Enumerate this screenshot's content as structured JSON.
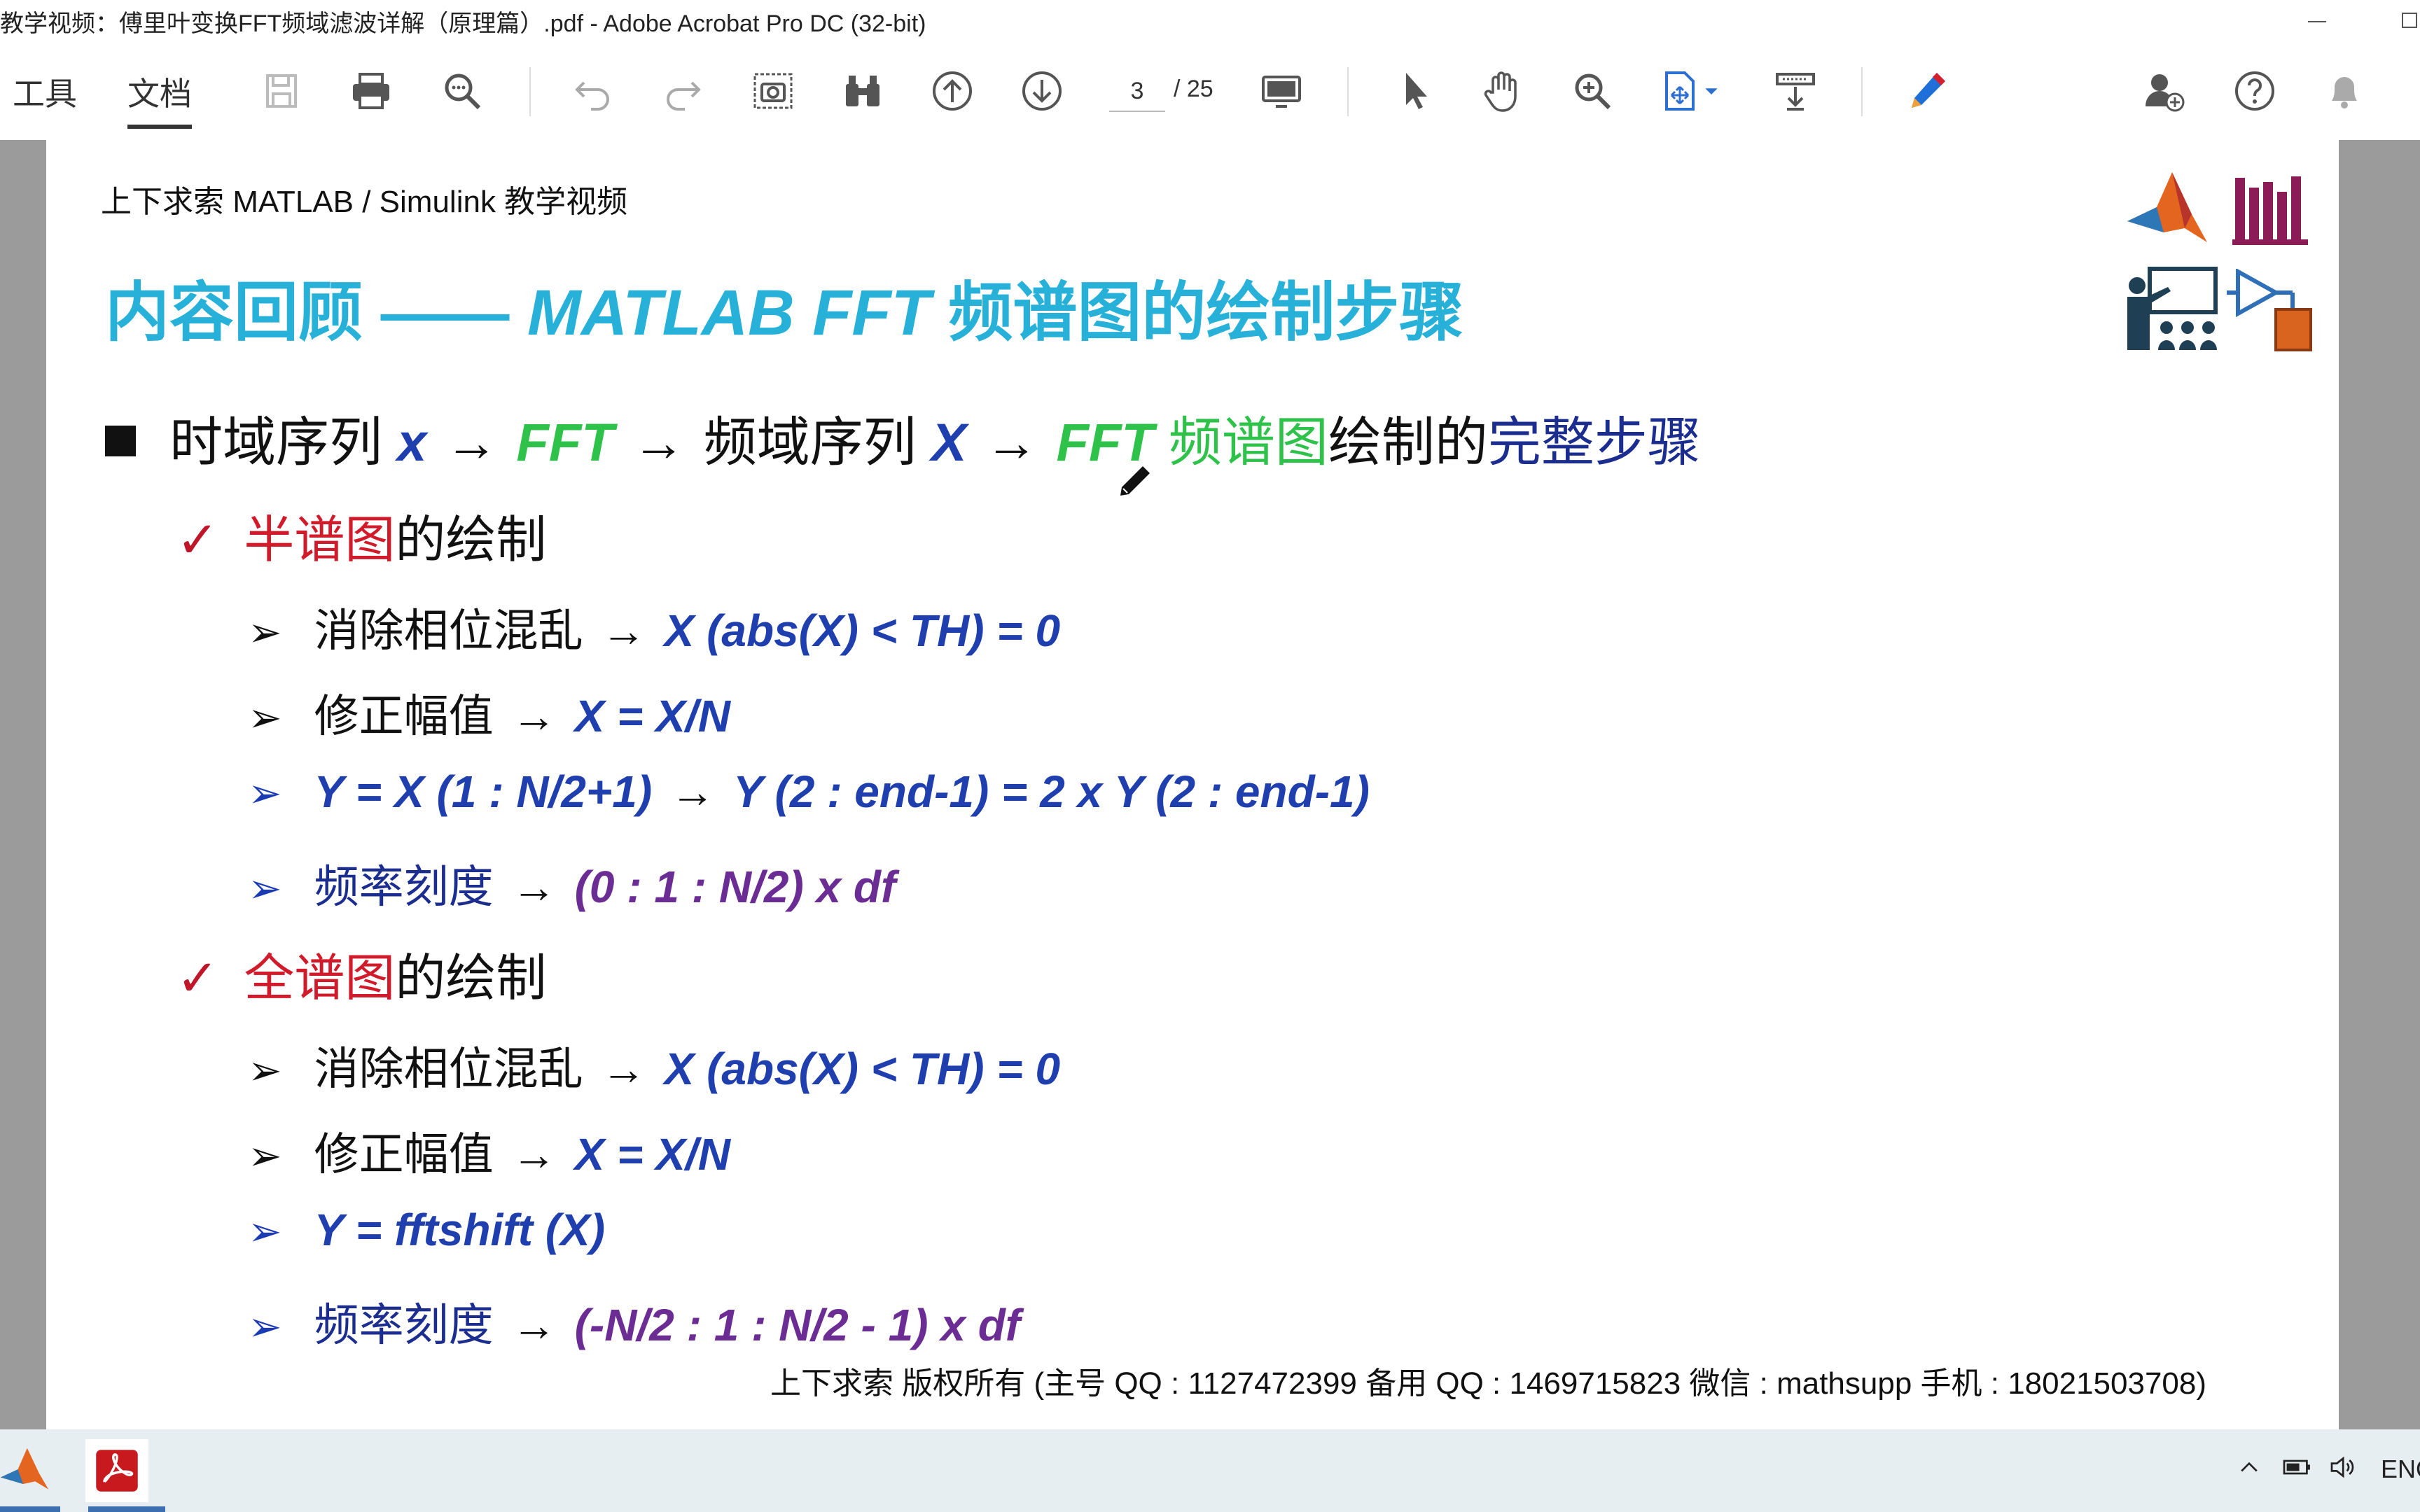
{
  "window": {
    "title": "教学视频：傅里叶变换FFT频域滤波详解（原理篇）.pdf - Adobe Acrobat Pro DC (32-bit)"
  },
  "toolbar": {
    "tab_tools": "工具",
    "tab_document": "文档",
    "page_current": "3",
    "page_total": "/ 25",
    "icons": [
      "save-icon",
      "print-icon",
      "search-icon",
      "undo-icon",
      "redo-icon",
      "snapshot-icon",
      "binoculars-icon",
      "page-up-icon",
      "page-down-icon",
      "read-mode-icon",
      "select-cursor-icon",
      "hand-icon",
      "zoom-in-icon",
      "organize-icon",
      "export-icon",
      "pen-icon",
      "add-user-icon",
      "help-icon",
      "bell-icon"
    ]
  },
  "slide": {
    "header": "上下求索 MATLAB / Simulink 教学视频",
    "title_a": "内容回顾 —— ",
    "title_b": "MATLAB FFT",
    "title_c": " 频谱图的绘制步骤",
    "main": {
      "t1": "时域序列 ",
      "x": "x",
      "a1": "→",
      "fft": "FFT",
      "a2": "→",
      "t2": "频域序列 ",
      "X": "X",
      "a3": "→",
      "fft2": "FFT",
      "t3": " 频谱图",
      "t4": "绘制的",
      "t5": "完整步骤"
    },
    "half": {
      "check": "✓",
      "red": "半谱图",
      "rest": "的绘制",
      "items": [
        {
          "label": "消除相位混乱",
          "arrow": "→",
          "formula": "X (abs(X) < TH) = 0"
        },
        {
          "label": "修正幅值",
          "arrow": "→",
          "formula": "X = X/N"
        },
        {
          "label": "Y = X (1 : N/2+1)",
          "arrow": "→",
          "formula": "Y (2 : end-1) = 2 x Y (2 : end-1)"
        },
        {
          "label": "频率刻度",
          "arrow": "→",
          "formula": "(0 : 1 : N/2) x df"
        }
      ]
    },
    "full": {
      "check": "✓",
      "red": "全谱图",
      "rest": "的绘制",
      "items": [
        {
          "label": "消除相位混乱",
          "arrow": "→",
          "formula": "X (abs(X) < TH) = 0"
        },
        {
          "label": "修正幅值",
          "arrow": "→",
          "formula": "X = X/N"
        },
        {
          "label": "Y = fftshift (X)"
        },
        {
          "label": "频率刻度",
          "arrow": "→",
          "formula": "(-N/2 : 1 : N/2 - 1) x df"
        }
      ]
    },
    "footer": "上下求索  版权所有  (主号 QQ : 1127472399   备用 QQ : 1469715823   微信 : mathsupp   手机 : 18021503708)"
  },
  "taskbar": {
    "apps": [
      "matlab-icon",
      "acrobat-icon"
    ],
    "lang": "ENG"
  },
  "colors": {
    "title": "#27b1d9",
    "blue": "#1f3fae",
    "green": "#2fc24a",
    "red": "#d11a2a",
    "purple": "#6b2c94"
  }
}
